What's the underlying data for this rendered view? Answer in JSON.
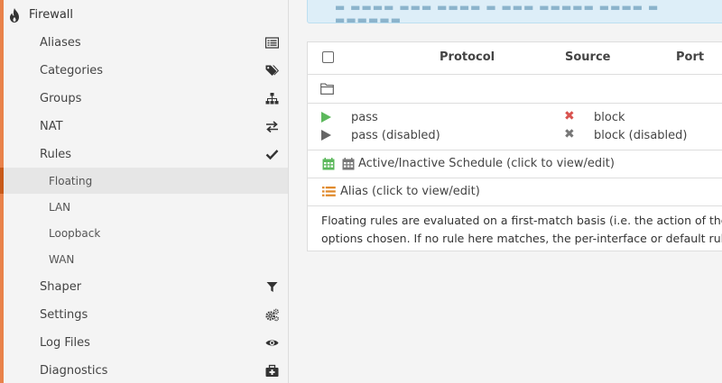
{
  "sidebar": {
    "header": {
      "label": "Firewall",
      "icon": "fire-icon"
    },
    "items": [
      {
        "label": "Aliases",
        "icon": "list-icon"
      },
      {
        "label": "Categories",
        "icon": "tags-icon"
      },
      {
        "label": "Groups",
        "icon": "sitemap-icon"
      },
      {
        "label": "NAT",
        "icon": "exchange-icon"
      },
      {
        "label": "Rules",
        "icon": "check-icon"
      }
    ],
    "rules_sub": [
      {
        "label": "Floating",
        "active": true
      },
      {
        "label": "LAN"
      },
      {
        "label": "Loopback"
      },
      {
        "label": "WAN"
      }
    ],
    "items_after": [
      {
        "label": "Shaper",
        "icon": "filter-icon"
      },
      {
        "label": "Settings",
        "icon": "cogs-icon"
      },
      {
        "label": "Log Files",
        "icon": "eye-icon"
      },
      {
        "label": "Diagnostics",
        "icon": "medkit-icon"
      }
    ]
  },
  "table": {
    "headers": {
      "protocol": "Protocol",
      "source": "Source",
      "port": "Port"
    }
  },
  "legend": {
    "pass": "pass",
    "pass_disabled": "pass (disabled)",
    "block": "block",
    "block_disabled": "block (disabled)",
    "schedule": "Active/Inactive Schedule (click to view/edit)",
    "alias": "Alias (click to view/edit)"
  },
  "note": {
    "line1": "Floating rules are evaluated on a first-match basis (i.e. the action of the first r",
    "line2": "options chosen. If no rule here matches, the per-interface or default rules are"
  },
  "colors": {
    "accent": "#e9824a",
    "pass": "#5cb85c",
    "block": "#d9534f",
    "schedule_green": "#5cb85c",
    "alias_orange": "#e08a2c"
  }
}
